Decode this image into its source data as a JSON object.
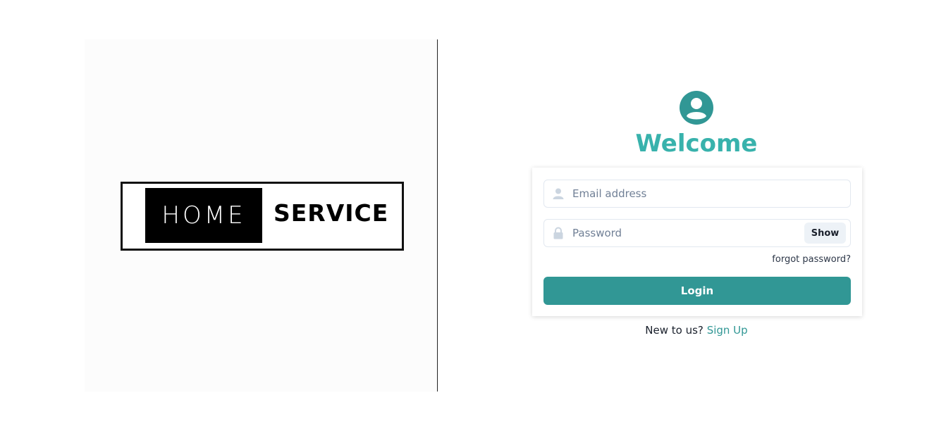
{
  "logo": {
    "word_home": "HOME",
    "word_service": "SERVICE"
  },
  "header": {
    "icon": "user-circle-icon",
    "title": "Welcome"
  },
  "form": {
    "email": {
      "icon": "user-icon",
      "value": "",
      "placeholder": "Email address"
    },
    "password": {
      "icon": "lock-icon",
      "value": "",
      "placeholder": "Password",
      "toggle_label": "Show"
    },
    "forgot_label": "forgot password?",
    "submit_label": "Login"
  },
  "footer": {
    "prompt": "New to us?",
    "signup_label": "Sign Up"
  },
  "colors": {
    "accent": "#319795",
    "heading": "#38b2ac",
    "input_border": "#e2e8f0",
    "placeholder": "#718096",
    "icon": "#cbd5e0",
    "show_button_bg": "#edf2f7"
  }
}
